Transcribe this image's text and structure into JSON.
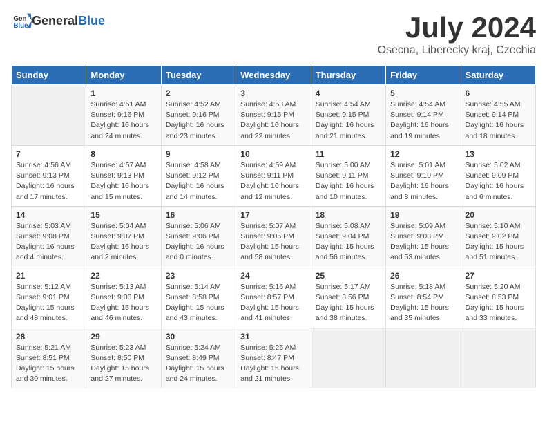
{
  "header": {
    "logo_general": "General",
    "logo_blue": "Blue",
    "month_year": "July 2024",
    "location": "Osecna, Liberecky kraj, Czechia"
  },
  "weekdays": [
    "Sunday",
    "Monday",
    "Tuesday",
    "Wednesday",
    "Thursday",
    "Friday",
    "Saturday"
  ],
  "weeks": [
    [
      {
        "day": "",
        "info": ""
      },
      {
        "day": "1",
        "info": "Sunrise: 4:51 AM\nSunset: 9:16 PM\nDaylight: 16 hours\nand 24 minutes."
      },
      {
        "day": "2",
        "info": "Sunrise: 4:52 AM\nSunset: 9:16 PM\nDaylight: 16 hours\nand 23 minutes."
      },
      {
        "day": "3",
        "info": "Sunrise: 4:53 AM\nSunset: 9:15 PM\nDaylight: 16 hours\nand 22 minutes."
      },
      {
        "day": "4",
        "info": "Sunrise: 4:54 AM\nSunset: 9:15 PM\nDaylight: 16 hours\nand 21 minutes."
      },
      {
        "day": "5",
        "info": "Sunrise: 4:54 AM\nSunset: 9:14 PM\nDaylight: 16 hours\nand 19 minutes."
      },
      {
        "day": "6",
        "info": "Sunrise: 4:55 AM\nSunset: 9:14 PM\nDaylight: 16 hours\nand 18 minutes."
      }
    ],
    [
      {
        "day": "7",
        "info": "Sunrise: 4:56 AM\nSunset: 9:13 PM\nDaylight: 16 hours\nand 17 minutes."
      },
      {
        "day": "8",
        "info": "Sunrise: 4:57 AM\nSunset: 9:13 PM\nDaylight: 16 hours\nand 15 minutes."
      },
      {
        "day": "9",
        "info": "Sunrise: 4:58 AM\nSunset: 9:12 PM\nDaylight: 16 hours\nand 14 minutes."
      },
      {
        "day": "10",
        "info": "Sunrise: 4:59 AM\nSunset: 9:11 PM\nDaylight: 16 hours\nand 12 minutes."
      },
      {
        "day": "11",
        "info": "Sunrise: 5:00 AM\nSunset: 9:11 PM\nDaylight: 16 hours\nand 10 minutes."
      },
      {
        "day": "12",
        "info": "Sunrise: 5:01 AM\nSunset: 9:10 PM\nDaylight: 16 hours\nand 8 minutes."
      },
      {
        "day": "13",
        "info": "Sunrise: 5:02 AM\nSunset: 9:09 PM\nDaylight: 16 hours\nand 6 minutes."
      }
    ],
    [
      {
        "day": "14",
        "info": "Sunrise: 5:03 AM\nSunset: 9:08 PM\nDaylight: 16 hours\nand 4 minutes."
      },
      {
        "day": "15",
        "info": "Sunrise: 5:04 AM\nSunset: 9:07 PM\nDaylight: 16 hours\nand 2 minutes."
      },
      {
        "day": "16",
        "info": "Sunrise: 5:06 AM\nSunset: 9:06 PM\nDaylight: 16 hours\nand 0 minutes."
      },
      {
        "day": "17",
        "info": "Sunrise: 5:07 AM\nSunset: 9:05 PM\nDaylight: 15 hours\nand 58 minutes."
      },
      {
        "day": "18",
        "info": "Sunrise: 5:08 AM\nSunset: 9:04 PM\nDaylight: 15 hours\nand 56 minutes."
      },
      {
        "day": "19",
        "info": "Sunrise: 5:09 AM\nSunset: 9:03 PM\nDaylight: 15 hours\nand 53 minutes."
      },
      {
        "day": "20",
        "info": "Sunrise: 5:10 AM\nSunset: 9:02 PM\nDaylight: 15 hours\nand 51 minutes."
      }
    ],
    [
      {
        "day": "21",
        "info": "Sunrise: 5:12 AM\nSunset: 9:01 PM\nDaylight: 15 hours\nand 48 minutes."
      },
      {
        "day": "22",
        "info": "Sunrise: 5:13 AM\nSunset: 9:00 PM\nDaylight: 15 hours\nand 46 minutes."
      },
      {
        "day": "23",
        "info": "Sunrise: 5:14 AM\nSunset: 8:58 PM\nDaylight: 15 hours\nand 43 minutes."
      },
      {
        "day": "24",
        "info": "Sunrise: 5:16 AM\nSunset: 8:57 PM\nDaylight: 15 hours\nand 41 minutes."
      },
      {
        "day": "25",
        "info": "Sunrise: 5:17 AM\nSunset: 8:56 PM\nDaylight: 15 hours\nand 38 minutes."
      },
      {
        "day": "26",
        "info": "Sunrise: 5:18 AM\nSunset: 8:54 PM\nDaylight: 15 hours\nand 35 minutes."
      },
      {
        "day": "27",
        "info": "Sunrise: 5:20 AM\nSunset: 8:53 PM\nDaylight: 15 hours\nand 33 minutes."
      }
    ],
    [
      {
        "day": "28",
        "info": "Sunrise: 5:21 AM\nSunset: 8:51 PM\nDaylight: 15 hours\nand 30 minutes."
      },
      {
        "day": "29",
        "info": "Sunrise: 5:23 AM\nSunset: 8:50 PM\nDaylight: 15 hours\nand 27 minutes."
      },
      {
        "day": "30",
        "info": "Sunrise: 5:24 AM\nSunset: 8:49 PM\nDaylight: 15 hours\nand 24 minutes."
      },
      {
        "day": "31",
        "info": "Sunrise: 5:25 AM\nSunset: 8:47 PM\nDaylight: 15 hours\nand 21 minutes."
      },
      {
        "day": "",
        "info": ""
      },
      {
        "day": "",
        "info": ""
      },
      {
        "day": "",
        "info": ""
      }
    ]
  ]
}
